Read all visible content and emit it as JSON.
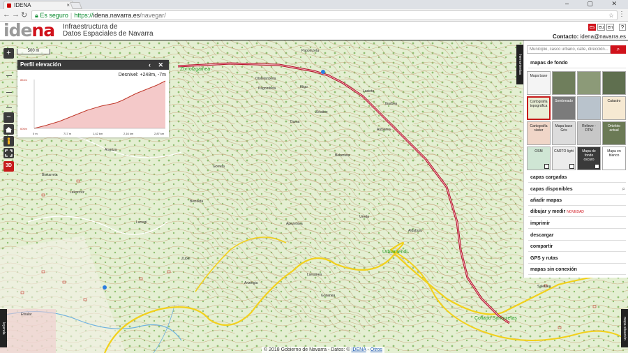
{
  "browser": {
    "tab_title": "IDENA",
    "tab_close": "×",
    "secure_label": "Es seguro",
    "url_scheme": "https://",
    "url_host": "idena.navarra.es",
    "url_path": "/navegar/",
    "window_controls": "– ▢ ✕"
  },
  "header": {
    "logo_part1": "ide",
    "logo_part2": "na",
    "subtitle_line1": "Infraestructura de",
    "subtitle_line2": "Datos Espaciales de Navarra",
    "languages": [
      "es",
      "eu",
      "en"
    ],
    "help_label": "?",
    "contact_label": "Contacto:",
    "contact_email": "idena@navarra.es"
  },
  "map": {
    "scale_label": "500 m",
    "zoom_in": "+",
    "zoom_out": "−",
    "btn_3d": "3D",
    "attribution_prefix": "© 2018 Gobierno de Navarra - Datos: ©",
    "attribution_link1": "IDENA",
    "attribution_sep": " - ",
    "attribution_link2": "Otros",
    "labels": [
      "Papoinzeta",
      "Olotelantxeta",
      "Pagoinbeta",
      "Lasieta",
      "Ibarbea",
      "Iñigo",
      "Zelaitxo",
      "Aizparea",
      "Dama",
      "Biskarreta",
      "Arantza",
      "Gorreta",
      "Belarrieta",
      "Lekarrotz",
      "Larregi",
      "Berroeta",
      "Apezetxea",
      "Ariztegia",
      "Aldaburu",
      "Gosanea",
      "Zubiri",
      "Larrainea",
      "Urreta",
      "Saletxea",
      "Etxalar"
    ],
    "green_labels": [
      "Zorrotzgainea",
      "Urbiamendi",
      "Collado Sanquietas"
    ]
  },
  "elevation": {
    "title": "Perfil elevación",
    "controls": "‹ ✕",
    "desnivel": "Desnivel: +248m, -7m",
    "y_max": "854m",
    "y_min": "606m",
    "x_ticks": [
      "0 m",
      "717 m",
      "1,42 km",
      "2,16 km",
      "2,87 km"
    ]
  },
  "panel": {
    "search_placeholder": "Municipio, casco urbano, calle, dirección...",
    "search_button": "⌕",
    "basemaps_title": "mapas de fondo",
    "basemaps": [
      "Mapa base",
      "",
      "",
      "",
      "Cartografía topográfica",
      "Sombreado",
      "",
      "Catastro",
      "Cartografía ráster",
      "Mapa base Gris",
      "Relieve - DTM",
      "Ortofoto actual",
      "OSM",
      "CARTO light",
      "Mapa de fondo oscuro",
      "Mapa en blanco"
    ],
    "menu": {
      "loaded": "capas cargadas",
      "available": "capas disponibles",
      "add": "añadir mapas",
      "draw": "dibujar y medir",
      "draw_badge": "NOVEDAD",
      "print": "imprimir",
      "download": "descargar",
      "share": "compartir",
      "gps": "GPS y rutas",
      "offline": "mapas sin conexión"
    },
    "toggle_tab": "herramientas"
  },
  "side_tabs": {
    "left": "leyenda",
    "right": "mapa situación"
  },
  "colors": {
    "brand_red": "#d0121b",
    "route": "#b3122b",
    "road": "#f2d11c"
  }
}
